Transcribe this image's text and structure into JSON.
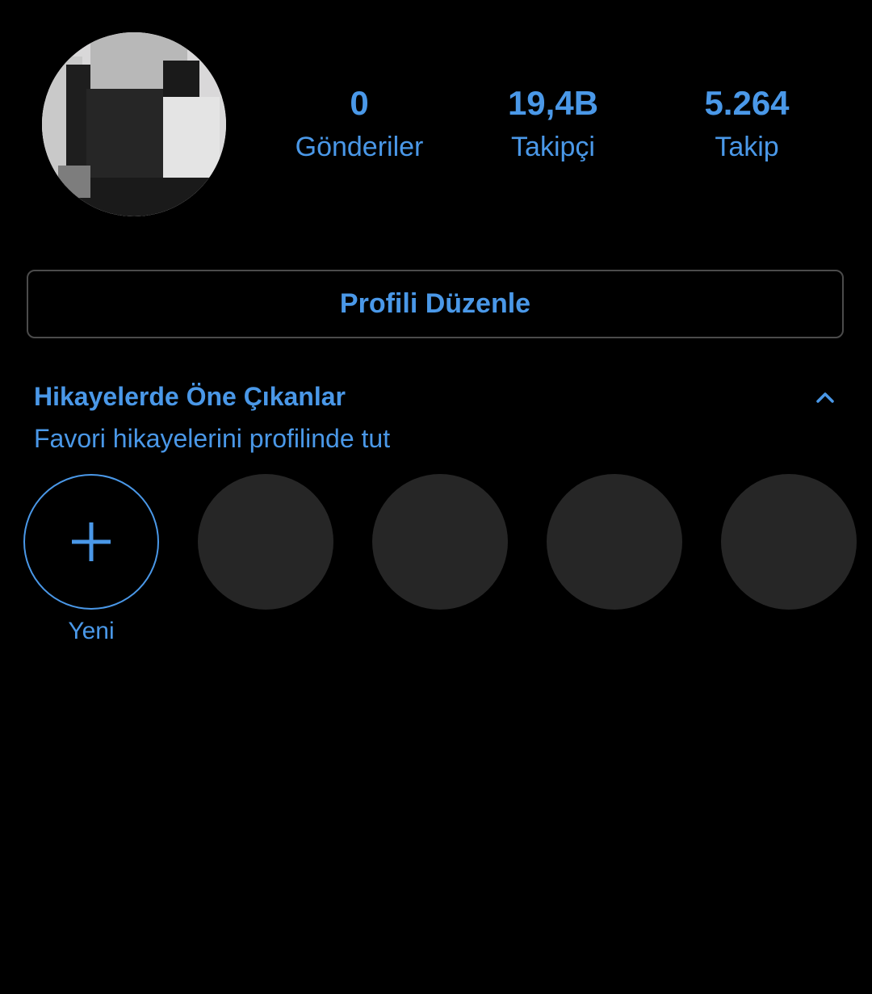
{
  "profile": {
    "avatar_icon": "profile-avatar-icon"
  },
  "stats": [
    {
      "value": "0",
      "label": "Gönderiler"
    },
    {
      "value": "19,4B",
      "label": "Takipçi"
    },
    {
      "value": "5.264",
      "label": "Takip"
    }
  ],
  "edit_profile": {
    "label": "Profili Düzenle"
  },
  "highlights": {
    "title": "Hikayelerde Öne Çıkanlar",
    "subtitle": "Favori hikayelerini profilinde tut",
    "collapse_icon": "chevron-up-icon",
    "new_label": "Yeni",
    "new_icon": "plus-icon",
    "placeholder_count": 4
  },
  "colors": {
    "background": "#000000",
    "accent": "#4a98e8",
    "placeholder": "#262626",
    "border": "#4b4b4b"
  }
}
